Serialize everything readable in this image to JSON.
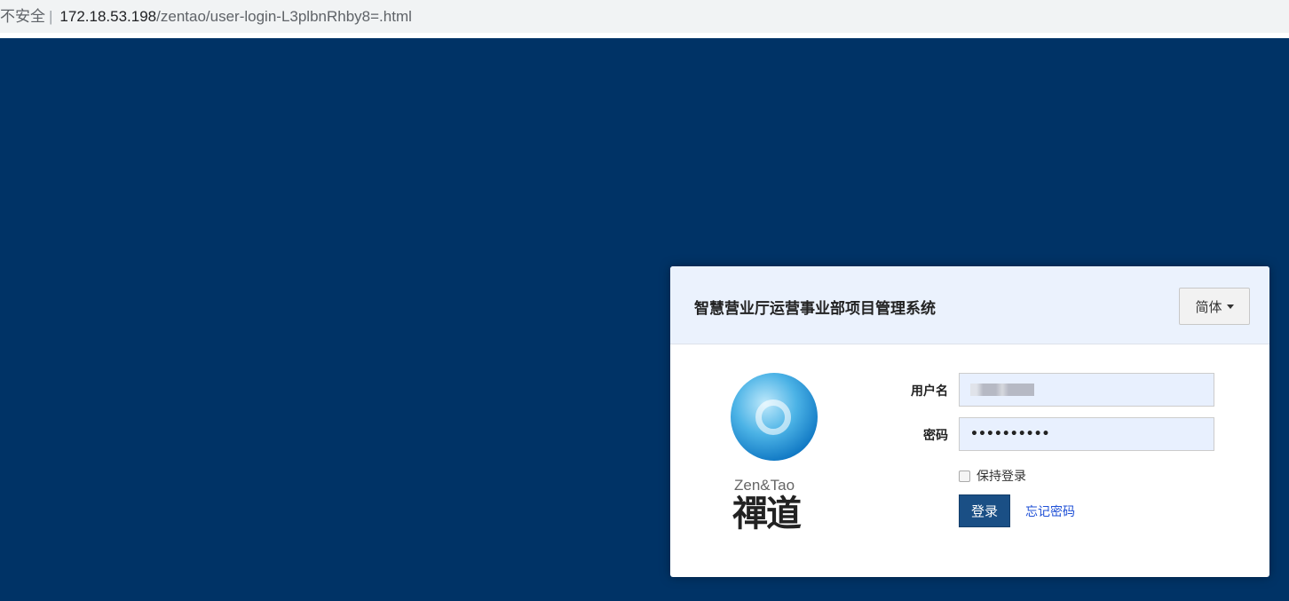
{
  "browser": {
    "security_label": "不安全",
    "url_host": "172.18.53.198",
    "url_path": "/zentao/user-login-L3plbnRhby8=.html"
  },
  "colors": {
    "background": "#003366",
    "header": "#ebf2fd",
    "button": "#1a4f85",
    "link": "#1f50d6"
  },
  "login": {
    "title": "智慧营业厅运营事业部项目管理系统",
    "language": "简体",
    "logo": {
      "brand_en": "Zen&Tao",
      "brand_cn": "禪道"
    },
    "username_label": "用户名",
    "password_label": "密码",
    "password_value": "••••••••••",
    "keep_login": "保持登录",
    "submit": "登录",
    "forgot": "忘记密码"
  }
}
